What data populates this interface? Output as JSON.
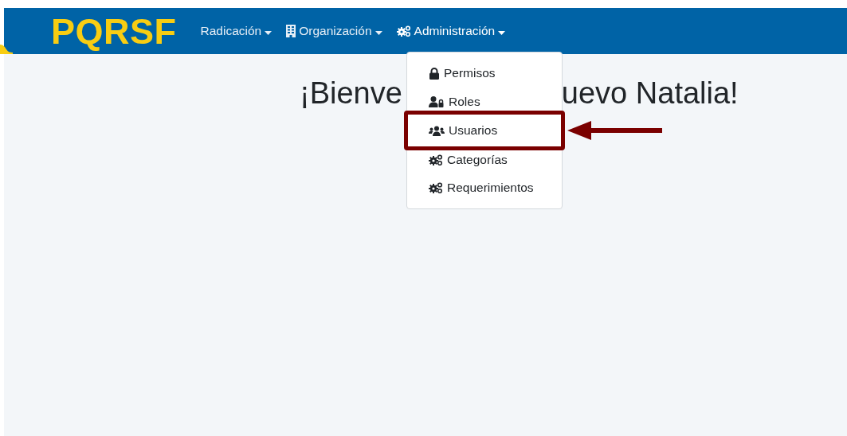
{
  "navbar": {
    "brand": "PQRSF",
    "items": [
      {
        "label": "Radicación",
        "expanded": false
      },
      {
        "label": "Organización",
        "expanded": false
      },
      {
        "label": "Administración",
        "expanded": true
      }
    ]
  },
  "heading_parts": [
    "¡Bienve",
    "uevo Natalia!"
  ],
  "dropdown": {
    "items": [
      {
        "label": "Permisos",
        "highlighted": false
      },
      {
        "label": "Roles",
        "highlighted": false
      },
      {
        "label": "Usuarios",
        "highlighted": true
      },
      {
        "label": "Categorías",
        "highlighted": false
      },
      {
        "label": "Requerimientos",
        "highlighted": false
      }
    ]
  }
}
